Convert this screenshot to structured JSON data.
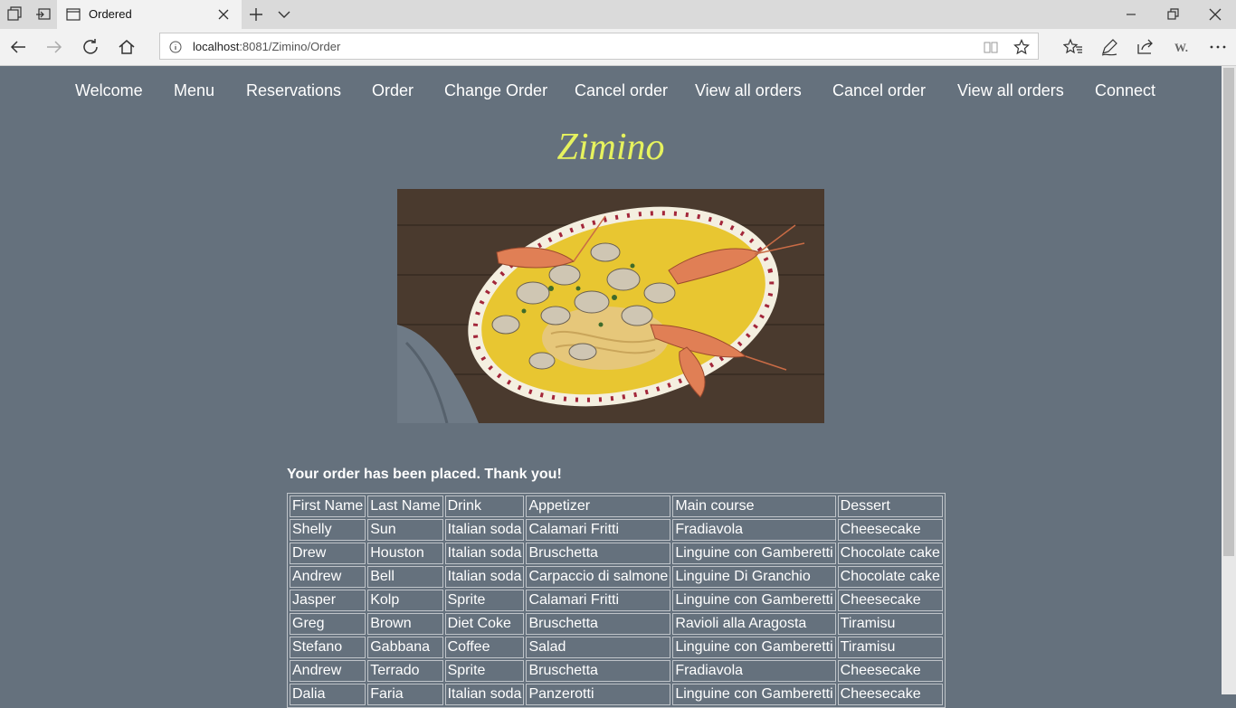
{
  "browser": {
    "tab_title": "Ordered",
    "url_host": "localhost",
    "url_path": ":8081/Zimino/Order"
  },
  "nav": [
    {
      "label": "Welcome"
    },
    {
      "label": "Menu"
    },
    {
      "label": "Reservations"
    },
    {
      "label": "Order"
    },
    {
      "label": "Change Order"
    },
    {
      "label": "Cancel order"
    },
    {
      "label": "View all orders"
    },
    {
      "label": "Cancel order"
    },
    {
      "label": "View all orders"
    },
    {
      "label": "Connect"
    }
  ],
  "brand": "Zimino",
  "photo_alt": "seafood-pasta-plate-photo",
  "message": "Your order has been placed. Thank you!",
  "table": {
    "headers": [
      "First Name",
      "Last Name",
      "Drink",
      "Appetizer",
      "Main course",
      "Dessert"
    ],
    "rows": [
      [
        "Shelly",
        "Sun",
        "Italian soda",
        "Calamari Fritti",
        "Fradiavola",
        "Cheesecake"
      ],
      [
        "Drew",
        "Houston",
        "Italian soda",
        "Bruschetta",
        "Linguine con Gamberetti",
        "Chocolate cake"
      ],
      [
        "Andrew",
        "Bell",
        "Italian soda",
        "Carpaccio di salmone",
        "Linguine Di Granchio",
        "Chocolate cake"
      ],
      [
        "Jasper",
        "Kolp",
        "Sprite",
        "Calamari Fritti",
        "Linguine con Gamberetti",
        "Cheesecake"
      ],
      [
        "Greg",
        "Brown",
        "Diet Coke",
        "Bruschetta",
        "Ravioli alla Aragosta",
        "Tiramisu"
      ],
      [
        "Stefano",
        "Gabbana",
        "Coffee",
        "Salad",
        "Linguine con Gamberetti",
        "Tiramisu"
      ],
      [
        "Andrew",
        "Terrado",
        "Sprite",
        "Bruschetta",
        "Fradiavola",
        "Cheesecake"
      ],
      [
        "Dalia",
        "Faria",
        "Italian soda",
        "Panzerotti",
        "Linguine con Gamberetti",
        "Cheesecake"
      ]
    ]
  },
  "colors": {
    "page_bg": "#65717d",
    "brand": "#e6f25e",
    "text": "#ffffff"
  }
}
